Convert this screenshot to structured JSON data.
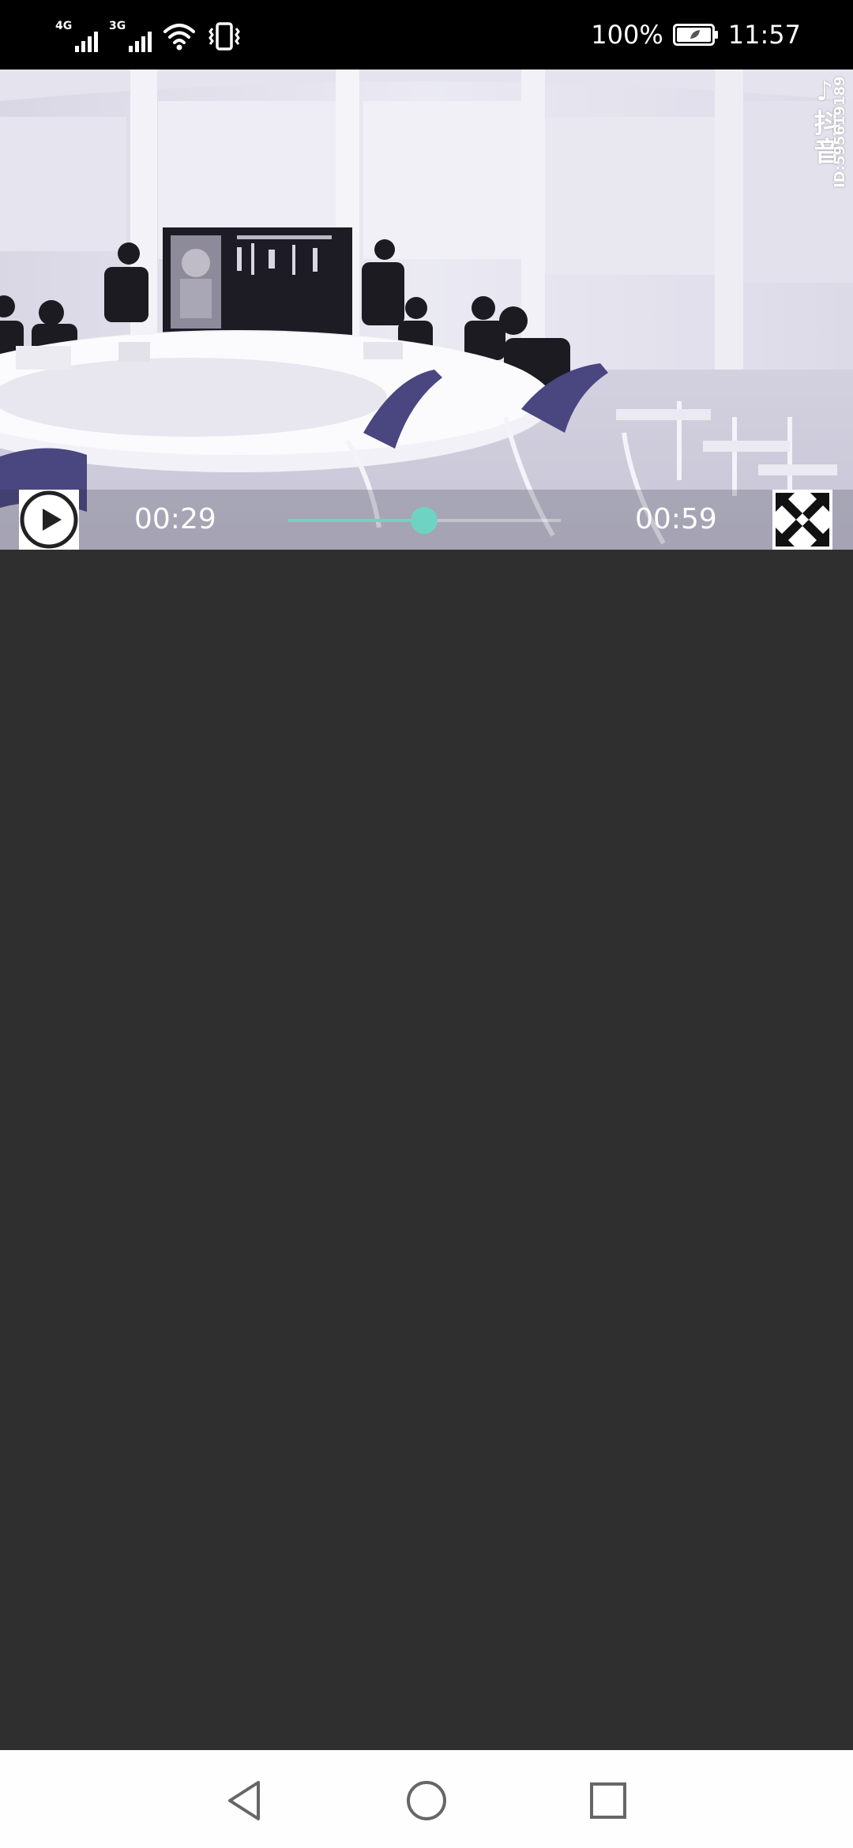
{
  "status_bar": {
    "network_1": "4G",
    "network_2": "3G",
    "battery_percent": "100%",
    "time": "11:57",
    "icons": [
      "signal-4g-icon",
      "signal-3g-icon",
      "wifi-icon",
      "vibrate-icon",
      "battery-icon"
    ]
  },
  "video": {
    "watermark_logo": "♪抖音",
    "watermark_id": "ID:595619189",
    "current_time": "00:29",
    "total_time": "00:59",
    "progress": 0.5,
    "accent_color": "#6fd3c3",
    "icons": [
      "play-icon",
      "fullscreen-icon"
    ]
  },
  "nav_bar": {
    "icons": [
      "back-icon",
      "home-icon",
      "recents-icon"
    ]
  }
}
